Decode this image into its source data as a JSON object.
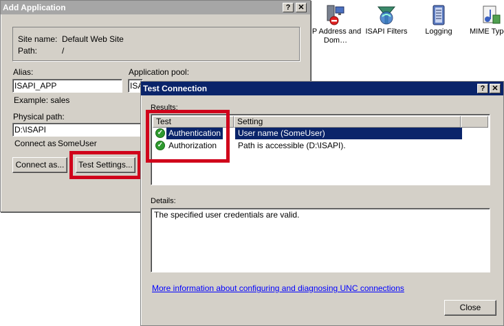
{
  "features": [
    {
      "icon": "ip-address-icon",
      "label": "IP Address and Dom…"
    },
    {
      "icon": "isapi-filters-icon",
      "label": "ISAPI Filters"
    },
    {
      "icon": "logging-icon",
      "label": "Logging"
    },
    {
      "icon": "mime-types-icon",
      "label": "MIME Type"
    }
  ],
  "add_app": {
    "title": "Add Application",
    "help_btn": "?",
    "close_btn": "✕",
    "site_name_label": "Site name:",
    "site_name_value": "Default Web Site",
    "path_label": "Path:",
    "path_value": "/",
    "alias_label": "Alias:",
    "alias_value": "ISAPI_APP",
    "app_pool_label": "Application pool:",
    "app_pool_value": "ISA",
    "example": "Example: sales",
    "physical_path_label": "Physical path:",
    "physical_path_value": "D:\\ISAPI",
    "connect_as_label": "Connect as",
    "connect_as_value": "SomeUser",
    "connect_as_btn": "Connect as...",
    "test_settings_btn": "Test Settings..."
  },
  "test_conn": {
    "title": "Test Connection",
    "help_btn": "?",
    "close_btn": "✕",
    "results_label": "Results:",
    "columns": [
      "Test",
      "Setting"
    ],
    "rows": [
      {
        "test": "Authentication",
        "setting": "User name  (SomeUser)",
        "status": "success"
      },
      {
        "test": "Authorization",
        "setting": "Path is accessible (D:\\ISAPI).",
        "status": "success"
      }
    ],
    "details_label": "Details:",
    "details_text": "The specified user credentials are valid.",
    "more_info_link": "More information about configuring and diagnosing UNC connections",
    "close_button": "Close"
  },
  "colors": {
    "highlight": "#d0021b",
    "selection": "#0a246a",
    "title_active": "#0a246a"
  }
}
